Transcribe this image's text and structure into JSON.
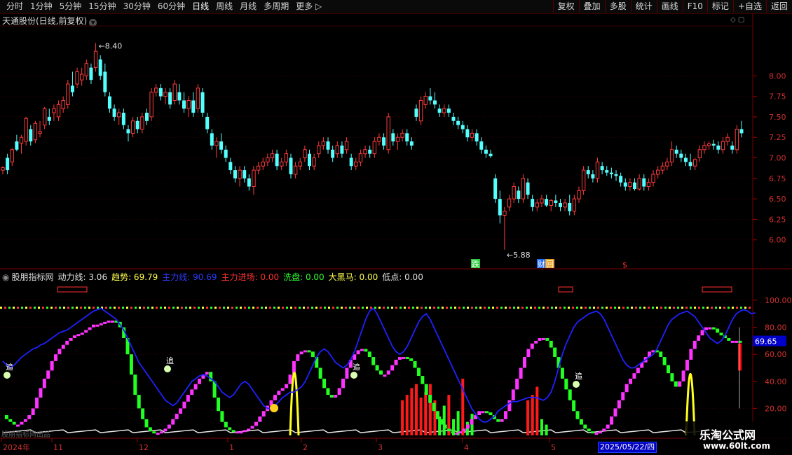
{
  "toolbar": {
    "left": [
      "分时",
      "1分钟",
      "5分钟",
      "15分钟",
      "30分钟",
      "60分钟",
      "日线",
      "周线",
      "月线",
      "多周期",
      "更多 ▷"
    ],
    "active": "日线",
    "right": [
      "复权",
      "叠加",
      "多股",
      "统计",
      "画线",
      "F10",
      "标记",
      "+自选",
      "返回"
    ]
  },
  "main_title": "天通股份(日线,前复权)",
  "indicator": {
    "name": "股朋指标网",
    "fields": [
      {
        "label": "动力线:",
        "value": "3.06",
        "color": "#e0e0e0"
      },
      {
        "label": "趋势:",
        "value": "69.79",
        "color": "#ffff50"
      },
      {
        "label": "主力线:",
        "value": "90.69",
        "color": "#2f3cff"
      },
      {
        "label": "主力进场:",
        "value": "0.00",
        "color": "#ff3030"
      },
      {
        "label": "洗盘:",
        "value": "0.00",
        "color": "#30ff30"
      },
      {
        "label": "大黑马:",
        "value": "0.00",
        "color": "#ffff50"
      },
      {
        "label": "低点:",
        "value": "0.00",
        "color": "#e0e0e0"
      }
    ]
  },
  "date_box": "2025/05/22/四",
  "faint_text": "股朋指标网出品",
  "watermark": {
    "line1": "乐淘公式网",
    "line2": "www.60lt.com"
  },
  "chart_data": {
    "type": "candlestick",
    "price_axis": {
      "ticks": [
        "8.00",
        "7.75",
        "7.50",
        "7.25",
        "7.00",
        "6.75",
        "6.50",
        "6.25",
        "6.00"
      ],
      "min": 5.75,
      "max": 8.6
    },
    "max_label": "8.40",
    "min_label": "5.88",
    "event_markers": [
      {
        "text": "跌",
        "x": 677
      },
      {
        "text": "财",
        "x": 771
      },
      {
        "text": "回",
        "x": 783
      },
      {
        "text": "$",
        "x": 888
      }
    ],
    "x_labels": [
      "2024年",
      "11",
      "12",
      "1",
      "2",
      "3",
      "4",
      "5"
    ],
    "indicator_axis": {
      "ticks": [
        "100.00",
        "80.00",
        "60.00",
        "40.00",
        "20.00"
      ],
      "current": "69.65",
      "min": 0,
      "max": 115
    },
    "chase_markers": [
      "追",
      "追",
      "追",
      "追"
    ],
    "candles": [
      [
        6.85,
        6.9,
        6.8,
        6.88
      ],
      [
        7,
        7.05,
        6.8,
        6.85
      ],
      [
        6.95,
        7.12,
        6.9,
        7.1
      ],
      [
        7.2,
        7.28,
        7.08,
        7.1
      ],
      [
        7.18,
        7.28,
        7.05,
        7.25
      ],
      [
        7.2,
        7.5,
        7.15,
        7.48
      ],
      [
        7.35,
        7.4,
        7.15,
        7.2
      ],
      [
        7.22,
        7.45,
        7.18,
        7.42
      ],
      [
        7.3,
        7.45,
        7.25,
        7.32
      ],
      [
        7.4,
        7.62,
        7.35,
        7.6
      ],
      [
        7.5,
        7.6,
        7.4,
        7.45
      ],
      [
        7.55,
        7.65,
        7.45,
        7.6
      ],
      [
        7.5,
        7.7,
        7.45,
        7.65
      ],
      [
        7.6,
        7.75,
        7.55,
        7.7
      ],
      [
        7.65,
        7.95,
        7.6,
        7.9
      ],
      [
        7.88,
        8.05,
        7.75,
        7.8
      ],
      [
        7.9,
        8.1,
        7.85,
        8.05
      ],
      [
        7.95,
        8.1,
        7.88,
        8.02
      ],
      [
        8,
        8.2,
        7.95,
        8.15
      ],
      [
        8.1,
        8.15,
        7.9,
        7.95
      ],
      [
        8.1,
        8.4,
        8.05,
        8.3
      ],
      [
        8.2,
        8.25,
        7.95,
        8
      ],
      [
        8.05,
        8.15,
        7.75,
        7.8
      ],
      [
        7.75,
        7.8,
        7.55,
        7.6
      ],
      [
        7.6,
        7.65,
        7.45,
        7.5
      ],
      [
        7.5,
        7.6,
        7.4,
        7.55
      ],
      [
        7.55,
        7.6,
        7.35,
        7.4
      ],
      [
        7.35,
        7.4,
        7.2,
        7.3
      ],
      [
        7.3,
        7.5,
        7.25,
        7.45
      ],
      [
        7.45,
        7.5,
        7.3,
        7.35
      ],
      [
        7.35,
        7.55,
        7.3,
        7.5
      ],
      [
        7.55,
        7.6,
        7.4,
        7.45
      ],
      [
        7.5,
        7.85,
        7.45,
        7.8
      ],
      [
        7.8,
        7.9,
        7.75,
        7.85
      ],
      [
        7.85,
        7.9,
        7.7,
        7.75
      ],
      [
        7.75,
        7.85,
        7.65,
        7.8
      ],
      [
        7.8,
        7.85,
        7.6,
        7.65
      ],
      [
        7.7,
        7.95,
        7.65,
        7.9
      ],
      [
        7.8,
        7.9,
        7.65,
        7.7
      ],
      [
        7.7,
        7.8,
        7.55,
        7.6
      ],
      [
        7.6,
        7.75,
        7.5,
        7.7
      ],
      [
        7.7,
        7.8,
        7.5,
        7.55
      ],
      [
        7.6,
        7.9,
        7.55,
        7.85
      ],
      [
        7.8,
        7.85,
        7.5,
        7.55
      ],
      [
        7.5,
        7.55,
        7.3,
        7.35
      ],
      [
        7.3,
        7.35,
        7.1,
        7.15
      ],
      [
        7.15,
        7.25,
        7,
        7.2
      ],
      [
        7.2,
        7.3,
        7.05,
        7.1
      ],
      [
        7.1,
        7.15,
        6.95,
        7
      ],
      [
        6.95,
        7,
        6.8,
        6.85
      ],
      [
        6.85,
        6.9,
        6.7,
        6.75
      ],
      [
        6.75,
        6.9,
        6.65,
        6.85
      ],
      [
        6.85,
        6.9,
        6.7,
        6.75
      ],
      [
        6.75,
        6.8,
        6.6,
        6.65
      ],
      [
        6.65,
        6.9,
        6.55,
        6.85
      ],
      [
        6.85,
        6.95,
        6.8,
        6.9
      ],
      [
        6.9,
        7,
        6.85,
        6.95
      ],
      [
        6.95,
        7.05,
        6.9,
        7
      ],
      [
        7,
        7.1,
        6.95,
        7.05
      ],
      [
        7.05,
        7.1,
        6.85,
        6.9
      ],
      [
        6.9,
        7,
        6.85,
        6.95
      ],
      [
        6.95,
        7.1,
        6.9,
        7.05
      ],
      [
        7,
        7.05,
        6.75,
        6.8
      ],
      [
        6.8,
        6.95,
        6.75,
        6.9
      ],
      [
        6.9,
        7,
        6.85,
        6.95
      ],
      [
        7,
        7.15,
        6.95,
        7.1
      ],
      [
        7.05,
        7.1,
        6.85,
        6.9
      ],
      [
        6.9,
        7.05,
        6.85,
        7
      ],
      [
        7.05,
        7.2,
        7,
        7.15
      ],
      [
        7.15,
        7.25,
        7.1,
        7.2
      ],
      [
        7.2,
        7.25,
        7.05,
        7.1
      ],
      [
        7.1,
        7.15,
        6.95,
        7
      ],
      [
        7.05,
        7.2,
        7,
        7.15
      ],
      [
        7.15,
        7.2,
        7,
        7.05
      ],
      [
        7.1,
        7.25,
        7.05,
        7.2
      ],
      [
        7,
        7.05,
        6.85,
        6.9
      ],
      [
        6.9,
        7,
        6.85,
        6.95
      ],
      [
        6.95,
        7.1,
        6.9,
        7.05
      ],
      [
        7.05,
        7.15,
        7,
        7.1
      ],
      [
        7.1,
        7.15,
        7,
        7.05
      ],
      [
        7.05,
        7.25,
        7,
        7.2
      ],
      [
        7.2,
        7.3,
        7.15,
        7.25
      ],
      [
        7.25,
        7.3,
        7.1,
        7.15
      ],
      [
        7.1,
        7.55,
        7.05,
        7.5
      ],
      [
        7.3,
        7.35,
        7.15,
        7.2
      ],
      [
        7.2,
        7.3,
        7.1,
        7.25
      ],
      [
        7.25,
        7.35,
        7.2,
        7.3
      ],
      [
        7.3,
        7.35,
        7.15,
        7.2
      ],
      [
        7.2,
        7.25,
        7.1,
        7.15
      ],
      [
        7.6,
        7.65,
        7.45,
        7.5
      ],
      [
        7.45,
        7.75,
        7.4,
        7.7
      ],
      [
        7.65,
        7.8,
        7.6,
        7.75
      ],
      [
        7.75,
        7.85,
        7.65,
        7.7
      ],
      [
        7.7,
        7.8,
        7.6,
        7.65
      ],
      [
        7.6,
        7.65,
        7.5,
        7.55
      ],
      [
        7.55,
        7.65,
        7.5,
        7.6
      ],
      [
        7.6,
        7.65,
        7.5,
        7.55
      ],
      [
        7.5,
        7.55,
        7.4,
        7.45
      ],
      [
        7.45,
        7.5,
        7.35,
        7.4
      ],
      [
        7.4,
        7.45,
        7.3,
        7.35
      ],
      [
        7.35,
        7.4,
        7.2,
        7.25
      ],
      [
        7.25,
        7.35,
        7.2,
        7.3
      ],
      [
        7.3,
        7.35,
        7.15,
        7.2
      ],
      [
        7.2,
        7.25,
        7.05,
        7.1
      ],
      [
        7.1,
        7.15,
        7,
        7.05
      ],
      [
        7.05,
        7.1,
        7,
        7.02
      ],
      [
        6.75,
        6.8,
        6.45,
        6.5
      ],
      [
        6.5,
        6.6,
        6.2,
        6.3
      ],
      [
        6.3,
        6.4,
        5.88,
        6.35
      ],
      [
        6.4,
        6.55,
        6.35,
        6.5
      ],
      [
        6.5,
        6.7,
        6.45,
        6.65
      ],
      [
        6.6,
        6.65,
        6.45,
        6.5
      ],
      [
        6.5,
        6.8,
        6.45,
        6.75
      ],
      [
        6.7,
        6.75,
        6.5,
        6.55
      ],
      [
        6.5,
        6.55,
        6.35,
        6.4
      ],
      [
        6.4,
        6.5,
        6.35,
        6.45
      ],
      [
        6.45,
        6.55,
        6.4,
        6.5
      ],
      [
        6.5,
        6.55,
        6.4,
        6.42
      ],
      [
        6.42,
        6.5,
        6.35,
        6.48
      ],
      [
        6.48,
        6.55,
        6.4,
        6.45
      ],
      [
        6.45,
        6.5,
        6.35,
        6.4
      ],
      [
        6.4,
        6.5,
        6.35,
        6.45
      ],
      [
        6.45,
        6.55,
        6.3,
        6.35
      ],
      [
        6.35,
        6.55,
        6.3,
        6.5
      ],
      [
        6.5,
        6.65,
        6.45,
        6.6
      ],
      [
        6.6,
        6.9,
        6.55,
        6.85
      ],
      [
        6.85,
        6.9,
        6.75,
        6.8
      ],
      [
        6.8,
        6.85,
        6.7,
        6.75
      ],
      [
        6.75,
        7,
        6.7,
        6.95
      ],
      [
        6.9,
        6.95,
        6.8,
        6.85
      ],
      [
        6.85,
        6.9,
        6.78,
        6.82
      ],
      [
        6.82,
        6.88,
        6.75,
        6.8
      ],
      [
        6.8,
        6.85,
        6.72,
        6.78
      ],
      [
        6.78,
        6.82,
        6.65,
        6.7
      ],
      [
        6.7,
        6.75,
        6.6,
        6.65
      ],
      [
        6.65,
        6.75,
        6.6,
        6.7
      ],
      [
        6.7,
        6.75,
        6.6,
        6.62
      ],
      [
        6.62,
        6.8,
        6.6,
        6.75
      ],
      [
        6.75,
        6.8,
        6.6,
        6.65
      ],
      [
        6.65,
        6.75,
        6.6,
        6.7
      ],
      [
        6.7,
        6.85,
        6.65,
        6.8
      ],
      [
        6.8,
        6.9,
        6.75,
        6.85
      ],
      [
        6.85,
        6.95,
        6.8,
        6.9
      ],
      [
        6.9,
        7,
        6.85,
        6.95
      ],
      [
        6.95,
        7.2,
        6.9,
        7.1
      ],
      [
        7.1,
        7.15,
        7,
        7.05
      ],
      [
        7.05,
        7.1,
        6.95,
        7
      ],
      [
        7,
        7.05,
        6.9,
        6.95
      ],
      [
        6.95,
        7.05,
        6.85,
        6.9
      ],
      [
        6.9,
        7,
        6.85,
        6.98
      ],
      [
        7,
        7.15,
        6.95,
        7.1
      ],
      [
        7.1,
        7.2,
        7.05,
        7.15
      ],
      [
        7.15,
        7.2,
        7.1,
        7.17
      ],
      [
        7.17,
        7.22,
        7.1,
        7.15
      ],
      [
        7.15,
        7.2,
        7.05,
        7.1
      ],
      [
        7.1,
        7.25,
        7.05,
        7.2
      ],
      [
        7.2,
        7.3,
        7.15,
        7.25
      ],
      [
        7.15,
        7.2,
        7.05,
        7.1
      ],
      [
        7.1,
        7.4,
        7.05,
        7.35
      ],
      [
        7.35,
        7.45,
        7.25,
        7.3
      ]
    ],
    "series": {
      "trend": [
        15,
        12,
        10,
        8,
        8,
        10,
        12,
        15,
        20,
        28,
        35,
        42,
        48,
        55,
        60,
        64,
        67,
        70,
        72,
        74,
        75,
        76,
        78,
        80,
        82,
        82,
        83,
        84,
        85,
        85,
        84,
        80,
        72,
        60,
        45,
        30,
        20,
        12,
        6,
        3,
        2,
        2,
        3,
        5,
        8,
        12,
        16,
        20,
        25,
        30,
        34,
        38,
        42,
        45,
        47,
        40,
        28,
        18,
        10,
        6,
        4,
        3,
        3,
        3,
        4,
        5,
        7,
        10,
        14,
        18,
        22,
        26,
        30,
        33,
        35,
        38,
        45,
        55,
        60,
        62,
        63,
        62,
        58,
        50,
        42,
        35,
        30,
        28,
        30,
        35,
        42,
        50,
        56,
        60,
        63,
        64,
        62,
        58,
        52,
        48,
        45,
        45,
        48,
        52,
        56,
        58,
        58,
        57,
        55,
        50,
        44,
        38,
        30,
        24,
        18,
        12,
        8,
        5,
        3,
        2,
        2,
        3,
        5,
        8,
        12,
        15,
        18,
        18,
        17,
        15,
        12,
        10,
        12,
        18,
        26,
        34,
        42,
        50,
        58,
        64,
        68,
        70,
        72,
        72,
        70,
        65,
        58,
        50,
        42,
        34,
        26,
        18,
        12,
        8,
        5,
        3,
        2,
        2,
        3,
        5,
        8,
        14,
        20,
        26,
        32,
        38,
        42,
        46,
        50,
        54,
        58,
        62,
        63,
        62,
        58,
        52,
        46,
        40,
        36,
        40,
        48,
        56,
        64,
        70,
        74,
        78,
        80,
        80,
        79,
        76,
        74,
        72,
        70,
        70,
        70,
        69.79
      ],
      "main": [
        55,
        52,
        50,
        52,
        55,
        58,
        60,
        62,
        64,
        65,
        67,
        68,
        70,
        72,
        74,
        76,
        77,
        78,
        80,
        82,
        84,
        86,
        88,
        90,
        92,
        93,
        94,
        92,
        90,
        88,
        86,
        82,
        78,
        72,
        66,
        60,
        54,
        50,
        46,
        42,
        38,
        34,
        30,
        26,
        24,
        22,
        24,
        28,
        32,
        36,
        40,
        42,
        44,
        45,
        44,
        42,
        40,
        36,
        32,
        30,
        28,
        30,
        34,
        38,
        40,
        38,
        34,
        30,
        26,
        22,
        20,
        20,
        22,
        25,
        28,
        30,
        32,
        32,
        34,
        36,
        40,
        46,
        52,
        58,
        62,
        64,
        62,
        58,
        54,
        52,
        50,
        52,
        56,
        62,
        70,
        78,
        86,
        92,
        94,
        90,
        84,
        78,
        72,
        66,
        62,
        60,
        62,
        66,
        72,
        78,
        84,
        88,
        90,
        86,
        80,
        74,
        68,
        62,
        56,
        50,
        44,
        38,
        32,
        26,
        20,
        16,
        12,
        10,
        10,
        12,
        14,
        18,
        20,
        22,
        24,
        25,
        25,
        26,
        27,
        28,
        28,
        28,
        27,
        26,
        28,
        32,
        40,
        50,
        60,
        68,
        74,
        80,
        84,
        86,
        88,
        90,
        91,
        92,
        90,
        86,
        80,
        74,
        68,
        62,
        56,
        52,
        50,
        50,
        52,
        54,
        56,
        58,
        60,
        64,
        70,
        76,
        82,
        86,
        88,
        90,
        91,
        92,
        90,
        88,
        84,
        80,
        76,
        72,
        70,
        68,
        70,
        74,
        80,
        86,
        90,
        92,
        93,
        92,
        90,
        90.69
      ]
    }
  }
}
